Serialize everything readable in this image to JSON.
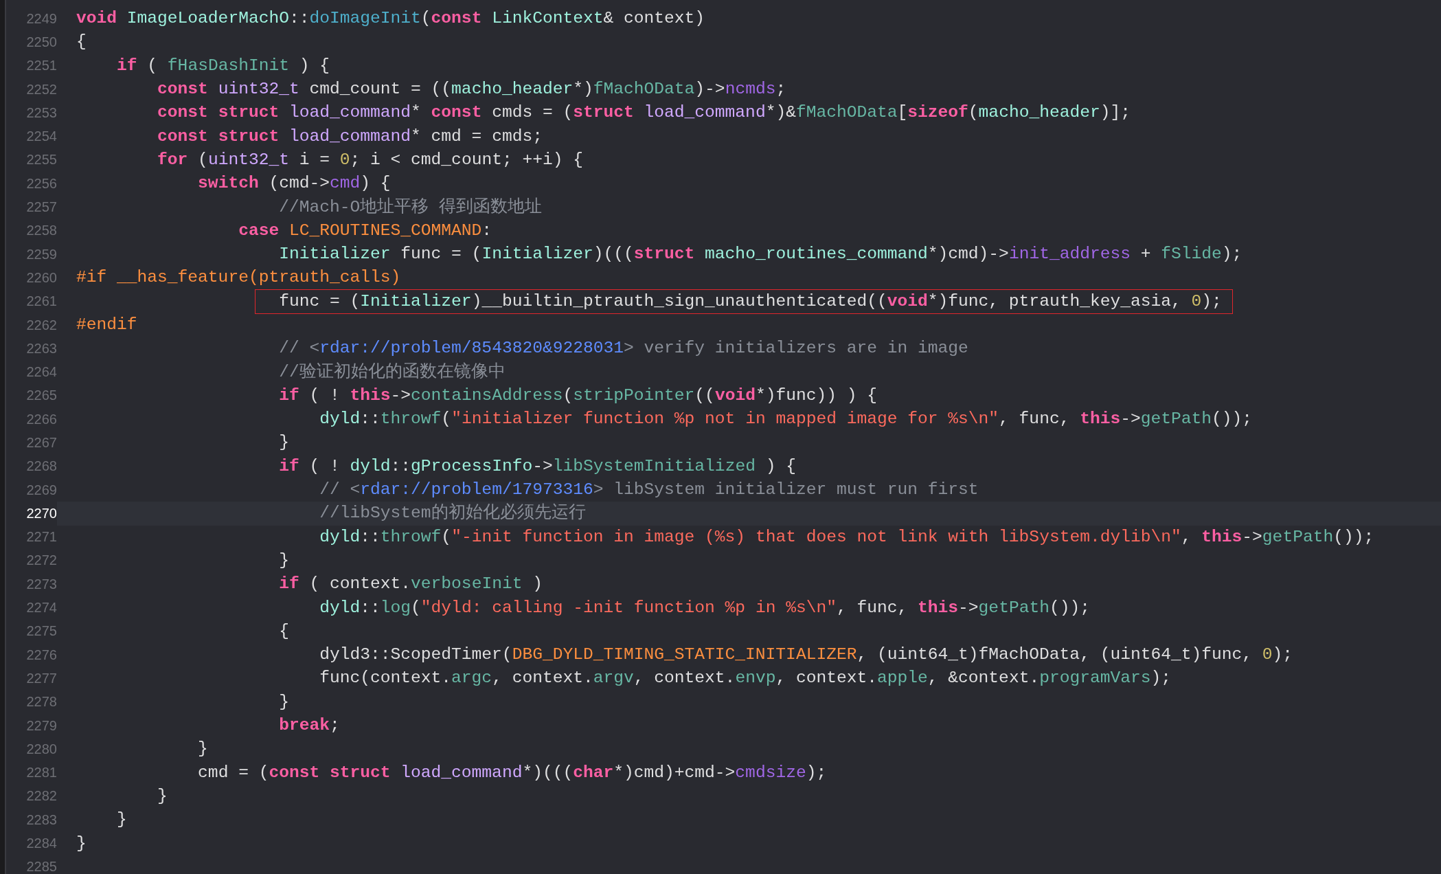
{
  "editor": {
    "lines": [
      {
        "number": "2249",
        "current": false,
        "boxed": false,
        "tokens": [
          {
            "kind": "keyword",
            "text": "void "
          },
          {
            "kind": "ptype",
            "text": "ImageLoaderMachO"
          },
          {
            "kind": "plain",
            "text": "::"
          },
          {
            "kind": "decl",
            "text": "doImageInit"
          },
          {
            "kind": "plain",
            "text": "("
          },
          {
            "kind": "keyword",
            "text": "const "
          },
          {
            "kind": "ptype",
            "text": "LinkContext"
          },
          {
            "kind": "plain",
            "text": "& context)"
          }
        ]
      },
      {
        "number": "2250",
        "current": false,
        "boxed": false,
        "tokens": [
          {
            "kind": "plain",
            "text": "{"
          }
        ]
      },
      {
        "number": "2251",
        "current": false,
        "boxed": false,
        "tokens": [
          {
            "kind": "keyword",
            "text": "    if"
          },
          {
            "kind": "plain",
            "text": " ( "
          },
          {
            "kind": "pvar",
            "text": "fHasDashInit"
          },
          {
            "kind": "plain",
            "text": " ) {"
          }
        ]
      },
      {
        "number": "2252",
        "current": false,
        "boxed": false,
        "tokens": [
          {
            "kind": "keyword",
            "text": "        const "
          },
          {
            "kind": "otype",
            "text": "uint32_t"
          },
          {
            "kind": "plain",
            "text": " cmd_count = (("
          },
          {
            "kind": "ptype",
            "text": "macho_header"
          },
          {
            "kind": "plain",
            "text": "*)"
          },
          {
            "kind": "pvar",
            "text": "fMachOData"
          },
          {
            "kind": "plain",
            "text": ")->"
          },
          {
            "kind": "oprop",
            "text": "ncmds"
          },
          {
            "kind": "plain",
            "text": ";"
          }
        ]
      },
      {
        "number": "2253",
        "current": false,
        "boxed": false,
        "tokens": [
          {
            "kind": "keyword",
            "text": "        const struct "
          },
          {
            "kind": "otype",
            "text": "load_command"
          },
          {
            "kind": "plain",
            "text": "* "
          },
          {
            "kind": "keyword",
            "text": "const"
          },
          {
            "kind": "plain",
            "text": " cmds = ("
          },
          {
            "kind": "keyword",
            "text": "struct "
          },
          {
            "kind": "otype",
            "text": "load_command"
          },
          {
            "kind": "plain",
            "text": "*)&"
          },
          {
            "kind": "pvar",
            "text": "fMachOData"
          },
          {
            "kind": "plain",
            "text": "["
          },
          {
            "kind": "keyword",
            "text": "sizeof"
          },
          {
            "kind": "plain",
            "text": "("
          },
          {
            "kind": "ptype",
            "text": "macho_header"
          },
          {
            "kind": "plain",
            "text": ")];"
          }
        ]
      },
      {
        "number": "2254",
        "current": false,
        "boxed": false,
        "tokens": [
          {
            "kind": "keyword",
            "text": "        const struct "
          },
          {
            "kind": "otype",
            "text": "load_command"
          },
          {
            "kind": "plain",
            "text": "* cmd = cmds;"
          }
        ]
      },
      {
        "number": "2255",
        "current": false,
        "boxed": false,
        "tokens": [
          {
            "kind": "keyword",
            "text": "        for"
          },
          {
            "kind": "plain",
            "text": " ("
          },
          {
            "kind": "otype",
            "text": "uint32_t"
          },
          {
            "kind": "plain",
            "text": " i = "
          },
          {
            "kind": "number",
            "text": "0"
          },
          {
            "kind": "plain",
            "text": "; i < cmd_count; ++i) {"
          }
        ]
      },
      {
        "number": "2256",
        "current": false,
        "boxed": false,
        "tokens": [
          {
            "kind": "keyword",
            "text": "            switch"
          },
          {
            "kind": "plain",
            "text": " (cmd->"
          },
          {
            "kind": "oprop",
            "text": "cmd"
          },
          {
            "kind": "plain",
            "text": ") {"
          }
        ]
      },
      {
        "number": "2257",
        "current": false,
        "boxed": false,
        "tokens": [
          {
            "kind": "comment",
            "text": "                    //Mach-O地址平移 得到函数地址"
          }
        ]
      },
      {
        "number": "2258",
        "current": false,
        "boxed": false,
        "tokens": [
          {
            "kind": "keyword",
            "text": "                case "
          },
          {
            "kind": "preproc",
            "text": "LC_ROUTINES_COMMAND"
          },
          {
            "kind": "plain",
            "text": ":"
          }
        ]
      },
      {
        "number": "2259",
        "current": false,
        "boxed": false,
        "tokens": [
          {
            "kind": "ptype",
            "text": "                    Initializer"
          },
          {
            "kind": "plain",
            "text": " func = ("
          },
          {
            "kind": "ptype",
            "text": "Initializer"
          },
          {
            "kind": "plain",
            "text": ")((("
          },
          {
            "kind": "keyword",
            "text": "struct "
          },
          {
            "kind": "ptype",
            "text": "macho_routines_command"
          },
          {
            "kind": "plain",
            "text": "*)cmd)->"
          },
          {
            "kind": "oprop",
            "text": "init_address"
          },
          {
            "kind": "plain",
            "text": " + "
          },
          {
            "kind": "pvar",
            "text": "fSlide"
          },
          {
            "kind": "plain",
            "text": ");"
          }
        ]
      },
      {
        "number": "2260",
        "current": false,
        "boxed": false,
        "tokens": [
          {
            "kind": "preproc",
            "text": "#if __has_feature(ptrauth_calls)"
          }
        ]
      },
      {
        "number": "2261",
        "current": false,
        "boxed": true,
        "tokens": [
          {
            "kind": "plain",
            "text": "                    func = ("
          },
          {
            "kind": "ptype",
            "text": "Initializer"
          },
          {
            "kind": "plain",
            "text": ")__builtin_ptrauth_sign_unauthenticated(("
          },
          {
            "kind": "keyword",
            "text": "void"
          },
          {
            "kind": "plain",
            "text": "*)func, ptrauth_key_asia, "
          },
          {
            "kind": "number",
            "text": "0"
          },
          {
            "kind": "plain",
            "text": ");"
          }
        ]
      },
      {
        "number": "2262",
        "current": false,
        "boxed": false,
        "tokens": [
          {
            "kind": "preproc",
            "text": "#endif"
          }
        ]
      },
      {
        "number": "2263",
        "current": false,
        "boxed": false,
        "tokens": [
          {
            "kind": "comment",
            "text": "                    // <"
          },
          {
            "kind": "link",
            "text": "rdar://problem/8543820&9228031"
          },
          {
            "kind": "comment",
            "text": "> verify initializers are in image"
          }
        ]
      },
      {
        "number": "2264",
        "current": false,
        "boxed": false,
        "tokens": [
          {
            "kind": "comment",
            "text": "                    //验证初始化的函数在镜像中"
          }
        ]
      },
      {
        "number": "2265",
        "current": false,
        "boxed": false,
        "tokens": [
          {
            "kind": "keyword",
            "text": "                    if"
          },
          {
            "kind": "plain",
            "text": " ( ! "
          },
          {
            "kind": "keyword",
            "text": "this"
          },
          {
            "kind": "plain",
            "text": "->"
          },
          {
            "kind": "pvar",
            "text": "containsAddress"
          },
          {
            "kind": "plain",
            "text": "("
          },
          {
            "kind": "pvar",
            "text": "stripPointer"
          },
          {
            "kind": "plain",
            "text": "(("
          },
          {
            "kind": "keyword",
            "text": "void"
          },
          {
            "kind": "plain",
            "text": "*)func)) ) {"
          }
        ]
      },
      {
        "number": "2266",
        "current": false,
        "boxed": false,
        "tokens": [
          {
            "kind": "ptype",
            "text": "                        dyld"
          },
          {
            "kind": "plain",
            "text": "::"
          },
          {
            "kind": "pvar",
            "text": "throwf"
          },
          {
            "kind": "plain",
            "text": "("
          },
          {
            "kind": "string",
            "text": "\"initializer function %p not in mapped image for %s\\n\""
          },
          {
            "kind": "plain",
            "text": ", func, "
          },
          {
            "kind": "keyword",
            "text": "this"
          },
          {
            "kind": "plain",
            "text": "->"
          },
          {
            "kind": "pvar",
            "text": "getPath"
          },
          {
            "kind": "plain",
            "text": "());"
          }
        ]
      },
      {
        "number": "2267",
        "current": false,
        "boxed": false,
        "tokens": [
          {
            "kind": "plain",
            "text": "                    }"
          }
        ]
      },
      {
        "number": "2268",
        "current": false,
        "boxed": false,
        "tokens": [
          {
            "kind": "keyword",
            "text": "                    if"
          },
          {
            "kind": "plain",
            "text": " ( ! "
          },
          {
            "kind": "ptype",
            "text": "dyld"
          },
          {
            "kind": "plain",
            "text": "::"
          },
          {
            "kind": "ptype",
            "text": "gProcessInfo"
          },
          {
            "kind": "plain",
            "text": "->"
          },
          {
            "kind": "pvar",
            "text": "libSystemInitialized"
          },
          {
            "kind": "plain",
            "text": " ) {"
          }
        ]
      },
      {
        "number": "2269",
        "current": false,
        "boxed": false,
        "tokens": [
          {
            "kind": "comment",
            "text": "                        // <"
          },
          {
            "kind": "link",
            "text": "rdar://problem/17973316"
          },
          {
            "kind": "comment",
            "text": "> libSystem initializer must run first"
          }
        ]
      },
      {
        "number": "2270",
        "current": true,
        "boxed": false,
        "tokens": [
          {
            "kind": "comment",
            "text": "                        //libSystem的初始化必须先运行"
          }
        ]
      },
      {
        "number": "2271",
        "current": false,
        "boxed": false,
        "tokens": [
          {
            "kind": "ptype",
            "text": "                        dyld"
          },
          {
            "kind": "plain",
            "text": "::"
          },
          {
            "kind": "pvar",
            "text": "throwf"
          },
          {
            "kind": "plain",
            "text": "("
          },
          {
            "kind": "string",
            "text": "\"-init function in image (%s) that does not link with libSystem.dylib\\n\""
          },
          {
            "kind": "plain",
            "text": ", "
          },
          {
            "kind": "keyword",
            "text": "this"
          },
          {
            "kind": "plain",
            "text": "->"
          },
          {
            "kind": "pvar",
            "text": "getPath"
          },
          {
            "kind": "plain",
            "text": "());"
          }
        ]
      },
      {
        "number": "2272",
        "current": false,
        "boxed": false,
        "tokens": [
          {
            "kind": "plain",
            "text": "                    }"
          }
        ]
      },
      {
        "number": "2273",
        "current": false,
        "boxed": false,
        "tokens": [
          {
            "kind": "keyword",
            "text": "                    if"
          },
          {
            "kind": "plain",
            "text": " ( context."
          },
          {
            "kind": "pvar",
            "text": "verboseInit"
          },
          {
            "kind": "plain",
            "text": " )"
          }
        ]
      },
      {
        "number": "2274",
        "current": false,
        "boxed": false,
        "tokens": [
          {
            "kind": "ptype",
            "text": "                        dyld"
          },
          {
            "kind": "plain",
            "text": "::"
          },
          {
            "kind": "pvar",
            "text": "log"
          },
          {
            "kind": "plain",
            "text": "("
          },
          {
            "kind": "string",
            "text": "\"dyld: calling -init function %p in %s\\n\""
          },
          {
            "kind": "plain",
            "text": ", func, "
          },
          {
            "kind": "keyword",
            "text": "this"
          },
          {
            "kind": "plain",
            "text": "->"
          },
          {
            "kind": "pvar",
            "text": "getPath"
          },
          {
            "kind": "plain",
            "text": "());"
          }
        ]
      },
      {
        "number": "2275",
        "current": false,
        "boxed": false,
        "tokens": [
          {
            "kind": "plain",
            "text": "                    {"
          }
        ]
      },
      {
        "number": "2276",
        "current": false,
        "boxed": false,
        "tokens": [
          {
            "kind": "plain",
            "text": "                        dyld3::ScopedTimer("
          },
          {
            "kind": "preproc",
            "text": "DBG_DYLD_TIMING_STATIC_INITIALIZER"
          },
          {
            "kind": "plain",
            "text": ", (uint64_t)fMachOData, (uint64_t)func, "
          },
          {
            "kind": "number",
            "text": "0"
          },
          {
            "kind": "plain",
            "text": ");"
          }
        ]
      },
      {
        "number": "2277",
        "current": false,
        "boxed": false,
        "tokens": [
          {
            "kind": "plain",
            "text": "                        func(context."
          },
          {
            "kind": "pvar",
            "text": "argc"
          },
          {
            "kind": "plain",
            "text": ", context."
          },
          {
            "kind": "pvar",
            "text": "argv"
          },
          {
            "kind": "plain",
            "text": ", context."
          },
          {
            "kind": "pvar",
            "text": "envp"
          },
          {
            "kind": "plain",
            "text": ", context."
          },
          {
            "kind": "pvar",
            "text": "apple"
          },
          {
            "kind": "plain",
            "text": ", &context."
          },
          {
            "kind": "pvar",
            "text": "programVars"
          },
          {
            "kind": "plain",
            "text": ");"
          }
        ]
      },
      {
        "number": "2278",
        "current": false,
        "boxed": false,
        "tokens": [
          {
            "kind": "plain",
            "text": "                    }"
          }
        ]
      },
      {
        "number": "2279",
        "current": false,
        "boxed": false,
        "tokens": [
          {
            "kind": "keyword",
            "text": "                    break"
          },
          {
            "kind": "plain",
            "text": ";"
          }
        ]
      },
      {
        "number": "2280",
        "current": false,
        "boxed": false,
        "tokens": [
          {
            "kind": "plain",
            "text": "            }"
          }
        ]
      },
      {
        "number": "2281",
        "current": false,
        "boxed": false,
        "tokens": [
          {
            "kind": "plain",
            "text": "            cmd = ("
          },
          {
            "kind": "keyword",
            "text": "const struct "
          },
          {
            "kind": "otype",
            "text": "load_command"
          },
          {
            "kind": "plain",
            "text": "*)((("
          },
          {
            "kind": "keyword",
            "text": "char"
          },
          {
            "kind": "plain",
            "text": "*)cmd)+cmd->"
          },
          {
            "kind": "oprop",
            "text": "cmdsize"
          },
          {
            "kind": "plain",
            "text": ");"
          }
        ]
      },
      {
        "number": "2282",
        "current": false,
        "boxed": false,
        "tokens": [
          {
            "kind": "plain",
            "text": "        }"
          }
        ]
      },
      {
        "number": "2283",
        "current": false,
        "boxed": false,
        "tokens": [
          {
            "kind": "plain",
            "text": "    }"
          }
        ]
      },
      {
        "number": "2284",
        "current": false,
        "boxed": false,
        "tokens": [
          {
            "kind": "plain",
            "text": "}"
          }
        ]
      },
      {
        "number": "2285",
        "current": false,
        "boxed": false
      }
    ]
  }
}
